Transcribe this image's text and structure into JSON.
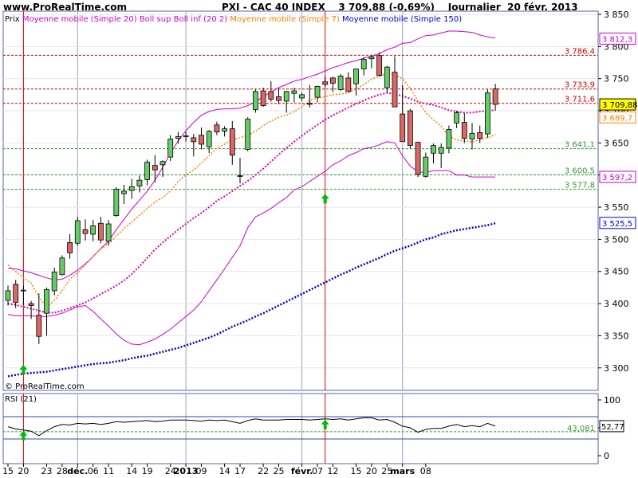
{
  "header": {
    "site": "www.ProRealTime.com",
    "title": "PXI - CAC 40 INDEX    3 709,88 (-0,69%)    Journalier  20 févr. 2013"
  },
  "chart_data": [
    {
      "type": "candlestick",
      "legend": {
        "items": [
          {
            "label": "Prix",
            "color": "#000000"
          },
          {
            "label": "Moyenne mobile (Simple 20)",
            "color": "#cc00cc"
          },
          {
            "label": "Boll sup Boll inf (20 2)",
            "color": "#cc00cc"
          },
          {
            "label": "Moyenne mobile (Simple 7)",
            "color": "#ff8000"
          },
          {
            "label": "Moyenne mobile (Simple 150)",
            "color": "#0000cc"
          }
        ]
      },
      "ylim": [
        3265,
        3855
      ],
      "yticks": [
        {
          "v": 3300,
          "label": "3 300"
        },
        {
          "v": 3350,
          "label": "3 350"
        },
        {
          "v": 3400,
          "label": "3 400"
        },
        {
          "v": 3450,
          "label": "3 450"
        },
        {
          "v": 3500,
          "label": "3 500"
        },
        {
          "v": 3550,
          "label": "3 550"
        },
        {
          "v": 3600,
          "label": "3 600"
        },
        {
          "v": 3650,
          "label": "3 650"
        },
        {
          "v": 3700,
          "label": "3 700"
        },
        {
          "v": 3750,
          "label": "3 750"
        },
        {
          "v": 3800,
          "label": "3 800"
        },
        {
          "v": 3850,
          "label": "3 850"
        }
      ],
      "xlabels": [
        {
          "i": 0,
          "label": "15",
          "bold": false
        },
        {
          "i": 2,
          "label": "20",
          "bold": false
        },
        {
          "i": 5,
          "label": "23",
          "bold": false
        },
        {
          "i": 7,
          "label": "28",
          "bold": false
        },
        {
          "i": 9,
          "label": "déc.",
          "bold": true
        },
        {
          "i": 11,
          "label": "06",
          "bold": false
        },
        {
          "i": 13,
          "label": "11",
          "bold": false
        },
        {
          "i": 16,
          "label": "14",
          "bold": false
        },
        {
          "i": 18,
          "label": "19",
          "bold": false
        },
        {
          "i": 21,
          "label": "24",
          "bold": false
        },
        {
          "i": 23,
          "label": "2013",
          "bold": true
        },
        {
          "i": 25,
          "label": "09",
          "bold": false
        },
        {
          "i": 28,
          "label": "14",
          "bold": false
        },
        {
          "i": 30,
          "label": "17",
          "bold": false
        },
        {
          "i": 33,
          "label": "22",
          "bold": false
        },
        {
          "i": 35,
          "label": "25",
          "bold": false
        },
        {
          "i": 38,
          "label": "févr.",
          "bold": true
        },
        {
          "i": 40,
          "label": "07",
          "bold": false
        },
        {
          "i": 42,
          "label": "12",
          "bold": false
        },
        {
          "i": 45,
          "label": "15",
          "bold": false
        },
        {
          "i": 47,
          "label": "20",
          "bold": false
        },
        {
          "i": 49,
          "label": "25",
          "bold": false
        },
        {
          "i": 51,
          "label": "mars",
          "bold": true
        },
        {
          "i": 54,
          "label": "08",
          "bold": false
        }
      ],
      "vgrid": [
        9,
        23,
        38,
        51
      ],
      "redlines": [
        2,
        41
      ],
      "candles": [
        {
          "o": 3405,
          "h": 3428,
          "l": 3397,
          "c": 3420
        },
        {
          "o": 3430,
          "h": 3437,
          "l": 3393,
          "c": 3402
        },
        {
          "o": 3420,
          "h": 3428,
          "l": 3398,
          "c": 3421
        },
        {
          "o": 3400,
          "h": 3404,
          "l": 3376,
          "c": 3397
        },
        {
          "o": 3382,
          "h": 3416,
          "l": 3337,
          "c": 3349
        },
        {
          "o": 3385,
          "h": 3425,
          "l": 3350,
          "c": 3422
        },
        {
          "o": 3420,
          "h": 3456,
          "l": 3413,
          "c": 3449
        },
        {
          "o": 3445,
          "h": 3475,
          "l": 3444,
          "c": 3471
        },
        {
          "o": 3495,
          "h": 3508,
          "l": 3470,
          "c": 3479
        },
        {
          "o": 3494,
          "h": 3535,
          "l": 3490,
          "c": 3529
        },
        {
          "o": 3515,
          "h": 3531,
          "l": 3498,
          "c": 3509
        },
        {
          "o": 3508,
          "h": 3530,
          "l": 3497,
          "c": 3521
        },
        {
          "o": 3525,
          "h": 3535,
          "l": 3494,
          "c": 3499
        },
        {
          "o": 3497,
          "h": 3530,
          "l": 3490,
          "c": 3524
        },
        {
          "o": 3537,
          "h": 3581,
          "l": 3535,
          "c": 3578
        },
        {
          "o": 3571,
          "h": 3585,
          "l": 3555,
          "c": 3575
        },
        {
          "o": 3576,
          "h": 3594,
          "l": 3563,
          "c": 3582
        },
        {
          "o": 3583,
          "h": 3599,
          "l": 3573,
          "c": 3592
        },
        {
          "o": 3593,
          "h": 3624,
          "l": 3584,
          "c": 3620
        },
        {
          "o": 3615,
          "h": 3631,
          "l": 3589,
          "c": 3608
        },
        {
          "o": 3616,
          "h": 3623,
          "l": 3597,
          "c": 3621
        },
        {
          "o": 3628,
          "h": 3662,
          "l": 3622,
          "c": 3656
        },
        {
          "o": 3657,
          "h": 3667,
          "l": 3649,
          "c": 3660
        },
        {
          "o": 3661,
          "h": 3667,
          "l": 3652,
          "c": 3661
        },
        {
          "o": 3658,
          "h": 3664,
          "l": 3629,
          "c": 3652
        },
        {
          "o": 3662,
          "h": 3674,
          "l": 3640,
          "c": 3648
        },
        {
          "o": 3644,
          "h": 3670,
          "l": 3634,
          "c": 3668
        },
        {
          "o": 3678,
          "h": 3683,
          "l": 3662,
          "c": 3667
        },
        {
          "o": 3668,
          "h": 3676,
          "l": 3660,
          "c": 3672
        },
        {
          "o": 3672,
          "h": 3684,
          "l": 3616,
          "c": 3631
        },
        {
          "o": 3599,
          "h": 3627,
          "l": 3587,
          "c": 3598
        },
        {
          "o": 3640,
          "h": 3690,
          "l": 3637,
          "c": 3687
        },
        {
          "o": 3702,
          "h": 3733,
          "l": 3697,
          "c": 3730
        },
        {
          "o": 3731,
          "h": 3736,
          "l": 3706,
          "c": 3708
        },
        {
          "o": 3730,
          "h": 3746,
          "l": 3714,
          "c": 3718
        },
        {
          "o": 3722,
          "h": 3735,
          "l": 3710,
          "c": 3716
        },
        {
          "o": 3715,
          "h": 3731,
          "l": 3697,
          "c": 3730
        },
        {
          "o": 3727,
          "h": 3736,
          "l": 3713,
          "c": 3731
        },
        {
          "o": 3720,
          "h": 3728,
          "l": 3715,
          "c": 3725
        },
        {
          "o": 3712,
          "h": 3740,
          "l": 3705,
          "c": 3710
        },
        {
          "o": 3721,
          "h": 3739,
          "l": 3713,
          "c": 3738
        },
        {
          "o": 3745,
          "h": 3753,
          "l": 3737,
          "c": 3741
        },
        {
          "o": 3751,
          "h": 3753,
          "l": 3729,
          "c": 3743
        },
        {
          "o": 3733,
          "h": 3757,
          "l": 3731,
          "c": 3754
        },
        {
          "o": 3751,
          "h": 3760,
          "l": 3729,
          "c": 3730
        },
        {
          "o": 3742,
          "h": 3764,
          "l": 3724,
          "c": 3765
        },
        {
          "o": 3765,
          "h": 3783,
          "l": 3755,
          "c": 3780
        },
        {
          "o": 3781,
          "h": 3785,
          "l": 3766,
          "c": 3784
        },
        {
          "o": 3786,
          "h": 3791,
          "l": 3753,
          "c": 3755
        },
        {
          "o": 3736,
          "h": 3770,
          "l": 3728,
          "c": 3768
        },
        {
          "o": 3760,
          "h": 3785,
          "l": 3735,
          "c": 3706
        },
        {
          "o": 3695,
          "h": 3740,
          "l": 3666,
          "c": 3652
        },
        {
          "o": 3700,
          "h": 3703,
          "l": 3641,
          "c": 3646
        },
        {
          "o": 3651,
          "h": 3652,
          "l": 3597,
          "c": 3601
        },
        {
          "o": 3598,
          "h": 3635,
          "l": 3596,
          "c": 3628
        },
        {
          "o": 3634,
          "h": 3649,
          "l": 3618,
          "c": 3646
        },
        {
          "o": 3634,
          "h": 3649,
          "l": 3611,
          "c": 3643
        },
        {
          "o": 3642,
          "h": 3677,
          "l": 3634,
          "c": 3671
        },
        {
          "o": 3681,
          "h": 3700,
          "l": 3673,
          "c": 3697
        },
        {
          "o": 3682,
          "h": 3696,
          "l": 3650,
          "c": 3657
        },
        {
          "o": 3656,
          "h": 3681,
          "l": 3640,
          "c": 3665
        },
        {
          "o": 3666,
          "h": 3677,
          "l": 3650,
          "c": 3657
        },
        {
          "o": 3664,
          "h": 3733,
          "l": 3658,
          "c": 3728
        },
        {
          "o": 3734,
          "h": 3742,
          "l": 3700,
          "c": 3710
        }
      ],
      "sma7": [
        3460,
        3450,
        3440,
        3432,
        3410,
        3395,
        3405,
        3420,
        3438,
        3448,
        3460,
        3474,
        3485,
        3493,
        3505,
        3517,
        3527,
        3537,
        3548,
        3558,
        3565,
        3575,
        3590,
        3600,
        3608,
        3619,
        3630,
        3642,
        3648,
        3655,
        3658,
        3662,
        3668,
        3677,
        3684,
        3690,
        3693,
        3699,
        3706,
        3716,
        3720,
        3722,
        3725,
        3726,
        3728,
        3734,
        3741,
        3749,
        3754,
        3758,
        3756,
        3750,
        3735,
        3715,
        3697,
        3686,
        3676,
        3660,
        3655,
        3653,
        3652,
        3655,
        3658,
        3663
      ],
      "sma20": [
        3400,
        3398,
        3395,
        3392,
        3389,
        3386,
        3386,
        3389,
        3393,
        3397,
        3402,
        3408,
        3415,
        3421,
        3428,
        3436,
        3446,
        3458,
        3471,
        3484,
        3495,
        3505,
        3515,
        3524,
        3533,
        3541,
        3550,
        3560,
        3567,
        3575,
        3583,
        3591,
        3600,
        3610,
        3621,
        3632,
        3642,
        3652,
        3661,
        3670,
        3678,
        3686,
        3693,
        3699,
        3705,
        3711,
        3716,
        3721,
        3725,
        3728,
        3726,
        3723,
        3719,
        3714,
        3711,
        3709,
        3705,
        3701,
        3699,
        3697,
        3697,
        3699,
        3700,
        3701
      ],
      "boll_up": [
        3455,
        3454,
        3451,
        3448,
        3444,
        3440,
        3437,
        3438,
        3444,
        3452,
        3462,
        3473,
        3486,
        3497,
        3515,
        3531,
        3547,
        3561,
        3575,
        3592,
        3612,
        3634,
        3653,
        3669,
        3682,
        3693,
        3699,
        3702,
        3703,
        3703,
        3704,
        3708,
        3714,
        3722,
        3729,
        3736,
        3741,
        3746,
        3749,
        3753,
        3757,
        3762,
        3767,
        3771,
        3775,
        3778,
        3782,
        3785,
        3789,
        3795,
        3799,
        3805,
        3806,
        3812,
        3817,
        3818,
        3821,
        3824,
        3824,
        3823,
        3822,
        3818,
        3815,
        3813
      ],
      "boll_lo": [
        3383,
        3381,
        3381,
        3381,
        3380,
        3380,
        3382,
        3385,
        3390,
        3395,
        3397,
        3388,
        3376,
        3365,
        3353,
        3343,
        3337,
        3336,
        3340,
        3345,
        3352,
        3360,
        3370,
        3380,
        3390,
        3403,
        3420,
        3437,
        3454,
        3472,
        3490,
        3518,
        3535,
        3541,
        3548,
        3557,
        3565,
        3577,
        3582,
        3590,
        3598,
        3606,
        3616,
        3622,
        3630,
        3635,
        3641,
        3643,
        3647,
        3652,
        3650,
        3630,
        3614,
        3605,
        3604,
        3607,
        3607,
        3607,
        3600,
        3600,
        3597,
        3597,
        3597,
        3597
      ],
      "sma150": [
        3287,
        3289,
        3291,
        3292,
        3293,
        3294,
        3296,
        3298,
        3300,
        3302,
        3304,
        3306,
        3307,
        3308,
        3310,
        3312,
        3315,
        3317,
        3319,
        3322,
        3325,
        3328,
        3331,
        3335,
        3339,
        3343,
        3347,
        3352,
        3358,
        3364,
        3369,
        3374,
        3380,
        3385,
        3391,
        3397,
        3403,
        3409,
        3415,
        3421,
        3427,
        3433,
        3439,
        3445,
        3450,
        3456,
        3461,
        3466,
        3471,
        3477,
        3482,
        3486,
        3490,
        3495,
        3500,
        3503,
        3508,
        3511,
        3514,
        3516,
        3518,
        3520,
        3522,
        3525
      ],
      "hlines": [
        {
          "v": 3786.4,
          "label": "3 786,4",
          "color": "#cc0000"
        },
        {
          "v": 3733.9,
          "label": "3 733,9",
          "color": "#cc0000"
        },
        {
          "v": 3711.6,
          "label": "3 711,6",
          "color": "#cc0000"
        },
        {
          "v": 3641.1,
          "label": "3 641,1",
          "color": "#339933"
        },
        {
          "v": 3600.5,
          "label": "3 600,5",
          "color": "#339933"
        },
        {
          "v": 3577.8,
          "label": "3 577,8",
          "color": "#339933"
        }
      ],
      "right_badges": [
        {
          "v": 3812.3,
          "label": "3 812,3",
          "color": "#cc00cc",
          "fill": "#ffffff"
        },
        {
          "v": 3709.88,
          "label": "3 709,88",
          "color": "#000000",
          "fill": "#ffff00"
        },
        {
          "v": 3689.7,
          "label": "3 689,7",
          "color": "#ff8000",
          "fill": "#ffffff"
        },
        {
          "v": 3597.2,
          "label": "3 597,2",
          "color": "#cc00cc",
          "fill": "#ffffff"
        },
        {
          "v": 3525.5,
          "label": "3 525,5",
          "color": "#0000cc",
          "fill": "#ffffff"
        }
      ],
      "arrows": [
        {
          "i": 2,
          "v": 3296
        },
        {
          "i": 41,
          "v": 3562
        }
      ],
      "copyright": "© ProRealTime.com"
    },
    {
      "type": "line",
      "title": "RSI (21)",
      "ylim": [
        0,
        100
      ],
      "yticks": [
        {
          "v": 0,
          "label": "0"
        },
        {
          "v": 50,
          "label": "50"
        },
        {
          "v": 100,
          "label": "100"
        }
      ],
      "levels": [
        70,
        30
      ],
      "ref_level": {
        "v": 43.081,
        "label": "43,081",
        "color": "#339933"
      },
      "last": {
        "label": "52,77"
      },
      "values": [
        52,
        48,
        46,
        44,
        36,
        45,
        52,
        56,
        55,
        58,
        57,
        58,
        56,
        58,
        61,
        60,
        61,
        62,
        63,
        61,
        62,
        64,
        64,
        64,
        63,
        62,
        64,
        63,
        64,
        61,
        58,
        63,
        66,
        64,
        64,
        64,
        65,
        65,
        65,
        64,
        65,
        66,
        65,
        66,
        64,
        66,
        68,
        68,
        64,
        65,
        60,
        53,
        50,
        42,
        47,
        49,
        49,
        53,
        56,
        52,
        54,
        52,
        58,
        53
      ],
      "arrows": [
        {
          "i": 2
        },
        {
          "i": 41
        }
      ]
    }
  ]
}
